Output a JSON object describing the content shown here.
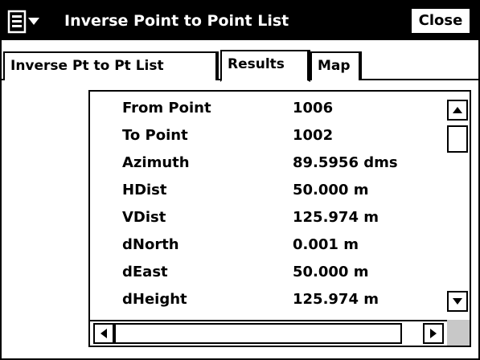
{
  "window": {
    "title": "Inverse Point to Point List",
    "close_label": "Close",
    "menu_icon": "menu-list-icon"
  },
  "tabs": [
    {
      "label": "Inverse Pt to Pt List",
      "active": false
    },
    {
      "label": "Results",
      "active": true
    },
    {
      "label": "Map",
      "active": false
    }
  ],
  "results": [
    {
      "label": "From Point",
      "value": "1006"
    },
    {
      "label": "To Point",
      "value": "1002"
    },
    {
      "label": "Azimuth",
      "value": "89.5956 dms"
    },
    {
      "label": "HDist",
      "value": "50.000 m"
    },
    {
      "label": "VDist",
      "value": "125.974 m"
    },
    {
      "label": "dNorth",
      "value": "0.001 m"
    },
    {
      "label": "dEast",
      "value": "50.000 m"
    },
    {
      "label": "dHeight",
      "value": "125.974 m"
    }
  ]
}
